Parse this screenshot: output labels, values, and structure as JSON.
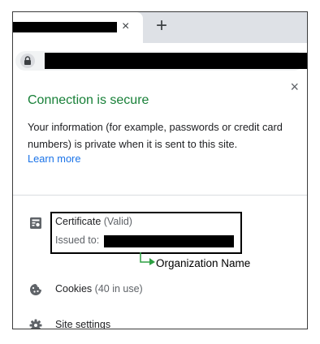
{
  "browser": {
    "tab_close_glyph": "×",
    "new_tab_glyph": "+"
  },
  "popup": {
    "close_glyph": "×",
    "title": "Connection is secure",
    "description": "Your information (for example, passwords or credit card numbers) is private when it is sent to this site.",
    "learn_more": "Learn more",
    "certificate": {
      "label": "Certificate",
      "status": "(Valid)",
      "issued_to_label": "Issued to:"
    },
    "annotation": "Organization Name",
    "cookies": {
      "label": "Cookies",
      "count": "(40 in use)"
    },
    "site_settings": "Site settings"
  },
  "colors": {
    "secure_green": "#188038",
    "link_blue": "#1a73e8",
    "annotation_arrow": "#2ea043"
  }
}
